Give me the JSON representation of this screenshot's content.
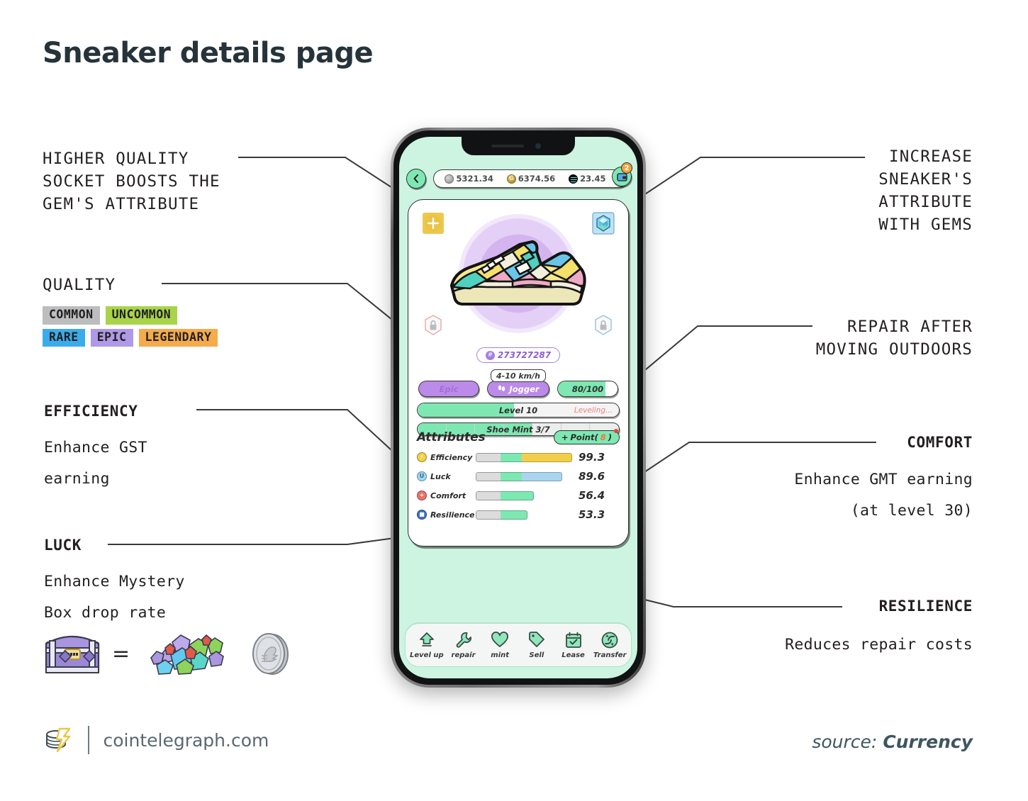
{
  "title": "Sneaker details page",
  "annotations": {
    "gem_socket": "HIGHER QUALITY\nSOCKET BOOSTS THE\nGEM'S ATTRIBUTE",
    "quality_label": "QUALITY",
    "efficiency_head": "EFFICIENCY",
    "efficiency_body": "Enhance GST\nearning",
    "luck_head": "LUCK",
    "luck_body": "Enhance Mystery\nBox drop rate",
    "increase_gems": "INCREASE\nSNEAKER'S\nATTRIBUTE\nWITH GEMS",
    "repair_outdoors": "REPAIR AFTER\nMOVING OUTDOORS",
    "comfort_head": "COMFORT",
    "comfort_body": "Enhance GMT earning\n(at level 30)",
    "resilience_head": "RESILIENCE",
    "resilience_body": "Reduces repair costs",
    "equals_sign": "="
  },
  "quality_badges": [
    {
      "label": "COMMON",
      "bg": "#bcbdbe"
    },
    {
      "label": "UNCOMMON",
      "bg": "#a8d44a"
    },
    {
      "label": "RARE",
      "bg": "#3aaceb"
    },
    {
      "label": "EPIC",
      "bg": "#ae9ae6"
    },
    {
      "label": "LEGENDARY",
      "bg": "#f4ab4c"
    }
  ],
  "phone": {
    "topbar": {
      "back_icon": "chevron-left-icon",
      "currencies": [
        {
          "icon": "gst-coin-icon",
          "value": "5321.34"
        },
        {
          "icon": "gmt-coin-icon",
          "value": "6374.56"
        },
        {
          "icon": "solana-coin-icon",
          "value": "23.45"
        }
      ],
      "wallet_icon": "wallet-icon",
      "wallet_badge": "2"
    },
    "sockets": [
      {
        "name": "socket-empty-yellow",
        "glyph": "+",
        "quality": "uncommon"
      },
      {
        "name": "socket-gem-blue",
        "glyph": "gem",
        "quality": "rare"
      },
      {
        "name": "socket-locked-pink",
        "glyph": "lock",
        "quality": "locked"
      },
      {
        "name": "socket-locked-blue",
        "glyph": "lock",
        "quality": "locked"
      }
    ],
    "shoe_id": "273727287",
    "speed_range": "4-10 km/h",
    "chips": {
      "quality": "Epic",
      "type": "Jogger",
      "durability": "80/100",
      "durability_pct": 80
    },
    "level_bar": {
      "label": "Level 10",
      "status": "Leveling...",
      "pct": 48
    },
    "mint_bar": {
      "label": "Shoe Mint 3/7",
      "used": 3,
      "total": 7
    },
    "attributes_title": "Attributes",
    "point_button": {
      "plus": "+",
      "label": "Point(",
      "count": "8",
      "close": ")"
    },
    "attributes": [
      {
        "name": "Efficiency",
        "value": "99.3",
        "icon_color": "#f2cf4a",
        "icon_glyph": "⚡",
        "base_pct": 26,
        "mid_pct": 22,
        "ext_pct": 52,
        "ext_color": "#f2cf4a"
      },
      {
        "name": "Luck",
        "value": "89.6",
        "icon_color": "#9fd6f2",
        "icon_glyph": "U",
        "base_pct": 26,
        "mid_pct": 22,
        "ext_pct": 42,
        "ext_color": "#aad5ef"
      },
      {
        "name": "Comfort",
        "value": "56.4",
        "icon_color": "#e8736b",
        "icon_glyph": "+",
        "base_pct": 26,
        "mid_pct": 34,
        "ext_pct": 0,
        "ext_color": "#7ee8b2"
      },
      {
        "name": "Resilience",
        "value": "53.3",
        "icon_color": "#3f72c4",
        "icon_glyph": "■",
        "base_pct": 26,
        "mid_pct": 28,
        "ext_pct": 0,
        "ext_color": "#7ee8b2"
      }
    ],
    "toolbar": [
      {
        "label": "Level up",
        "icon": "arrow-up-icon"
      },
      {
        "label": "repair",
        "icon": "wrench-icon"
      },
      {
        "label": "mint",
        "icon": "heart-icon"
      },
      {
        "label": "Sell",
        "icon": "price-tag-icon"
      },
      {
        "label": "Lease",
        "icon": "calendar-check-icon"
      },
      {
        "label": "Transfer",
        "icon": "refresh-circle-icon"
      }
    ]
  },
  "footer": {
    "site": "cointelegraph.com",
    "source_prefix": "source: ",
    "source_name": "Currency"
  },
  "colors": {
    "screen_bg": "#cdf3e1",
    "accent_green": "#7ee8b2",
    "purple": "#bc8ae8",
    "title": "#26333b"
  }
}
